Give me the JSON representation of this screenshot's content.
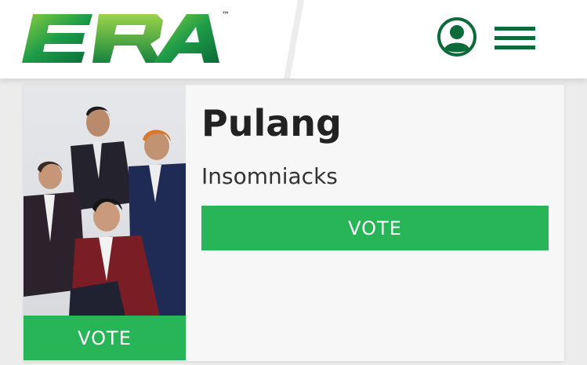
{
  "header": {
    "logo_text": "ERA",
    "trademark": "™",
    "account_icon": "user-circle-icon",
    "menu_icon": "hamburger-menu-icon",
    "brand_color": "#0b6b3a"
  },
  "entry": {
    "title": "Pulang",
    "artist": "Insomniacks",
    "vote_label": "VOTE",
    "photo_vote_label": "VOTE",
    "accent_color": "#27b558"
  }
}
